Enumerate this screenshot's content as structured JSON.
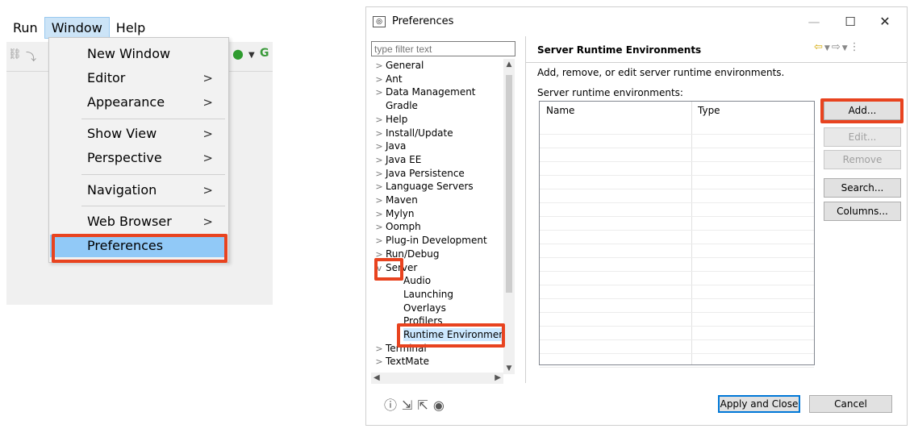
{
  "menubar": {
    "items": [
      "Run",
      "Window",
      "Help"
    ]
  },
  "window_menu": {
    "items": [
      {
        "label": "New Window",
        "submenu": false
      },
      {
        "label": "Editor",
        "submenu": true
      },
      {
        "label": "Appearance",
        "submenu": true
      },
      {
        "label": "Show View",
        "submenu": true
      },
      {
        "label": "Perspective",
        "submenu": true
      },
      {
        "label": "Navigation",
        "submenu": true
      },
      {
        "label": "Web Browser",
        "submenu": true
      },
      {
        "label": "Preferences",
        "submenu": false
      }
    ],
    "chevron": ">"
  },
  "dialog": {
    "title": "Preferences",
    "filter_placeholder": "type filter text",
    "tree": [
      {
        "label": "General",
        "exp": ">"
      },
      {
        "label": "Ant",
        "exp": ">"
      },
      {
        "label": "Data Management",
        "exp": ">"
      },
      {
        "label": "Gradle",
        "exp": ""
      },
      {
        "label": "Help",
        "exp": ">"
      },
      {
        "label": "Install/Update",
        "exp": ">"
      },
      {
        "label": "Java",
        "exp": ">"
      },
      {
        "label": "Java EE",
        "exp": ">"
      },
      {
        "label": "Java Persistence",
        "exp": ">"
      },
      {
        "label": "Language Servers",
        "exp": ">"
      },
      {
        "label": "Maven",
        "exp": ">"
      },
      {
        "label": "Mylyn",
        "exp": ">"
      },
      {
        "label": "Oomph",
        "exp": ">"
      },
      {
        "label": "Plug-in Development",
        "exp": ">"
      },
      {
        "label": "Run/Debug",
        "exp": ">"
      },
      {
        "label": "Server",
        "exp": "v"
      },
      {
        "label": "Audio",
        "exp": ""
      },
      {
        "label": "Launching",
        "exp": ""
      },
      {
        "label": "Overlays",
        "exp": ""
      },
      {
        "label": "Profilers",
        "exp": ""
      },
      {
        "label": "Runtime Environmer",
        "exp": ""
      },
      {
        "label": "Terminal",
        "exp": ">"
      },
      {
        "label": "TextMate",
        "exp": ">"
      }
    ],
    "page_title": "Server Runtime Environments",
    "description": "Add, remove, or edit server runtime environments.",
    "list_label": "Server runtime environments:",
    "columns": [
      "Name",
      "Type"
    ],
    "buttons": {
      "add": "Add...",
      "edit": "Edit...",
      "remove": "Remove",
      "search": "Search...",
      "columns": "Columns..."
    },
    "apply_close": "Apply and Close",
    "cancel": "Cancel"
  },
  "colors": {
    "highlight_box": "#e8431f",
    "menu_highlight": "#91c9f7",
    "tree_selected": "#cce8ff"
  }
}
